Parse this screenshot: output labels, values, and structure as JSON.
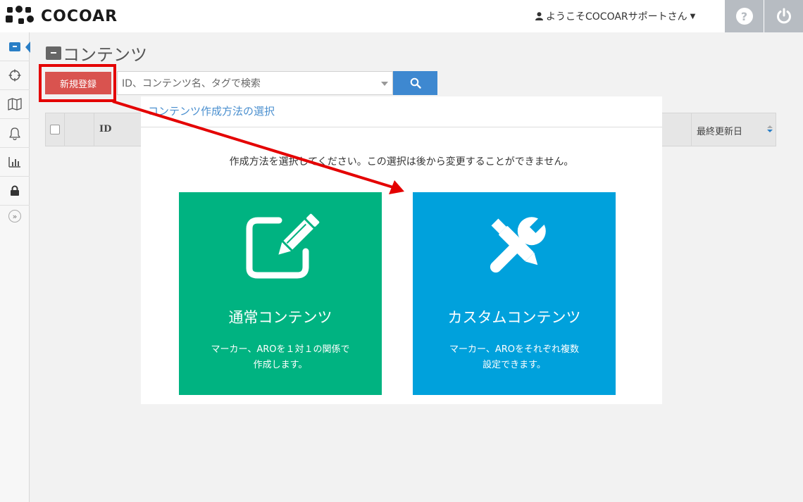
{
  "header": {
    "logo_text": "COCOAR",
    "user_greeting": "ようこそCOCOARサポートさん",
    "help_icon": "question-circle-icon",
    "power_icon": "power-icon"
  },
  "sidebar": {
    "items": [
      {
        "icon": "content-box-icon",
        "active": true
      },
      {
        "icon": "crosshair-icon",
        "active": false
      },
      {
        "icon": "map-icon",
        "active": false
      },
      {
        "icon": "bell-icon",
        "active": false
      },
      {
        "icon": "bar-chart-icon",
        "active": false
      },
      {
        "icon": "lock-icon",
        "active": false
      }
    ],
    "toggle_icon": "expand-chevrons-icon"
  },
  "page": {
    "title": "コンテンツ",
    "new_button_label": "新規登録",
    "search_placeholder": "ID、コンテンツ名、タグで検索"
  },
  "table": {
    "col_id": "ID",
    "col_updated": "最終更新日"
  },
  "modal": {
    "title": "コンテンツ作成方法の選択",
    "message": "作成方法を選択してください。この選択は後から変更することができません。",
    "cards": [
      {
        "title": "通常コンテンツ",
        "desc_line1": "マーカー、AROを１対１の関係で",
        "desc_line2": "作成します。",
        "color": "#00b381",
        "icon": "edit-pencil-icon"
      },
      {
        "title": "カスタムコンテンツ",
        "desc_line1": "マーカー、AROをそれぞれ複数",
        "desc_line2": "設定できます。",
        "color": "#00a1dc",
        "icon": "tools-icon"
      }
    ]
  },
  "annotation": {
    "highlight_color": "#e40000"
  }
}
